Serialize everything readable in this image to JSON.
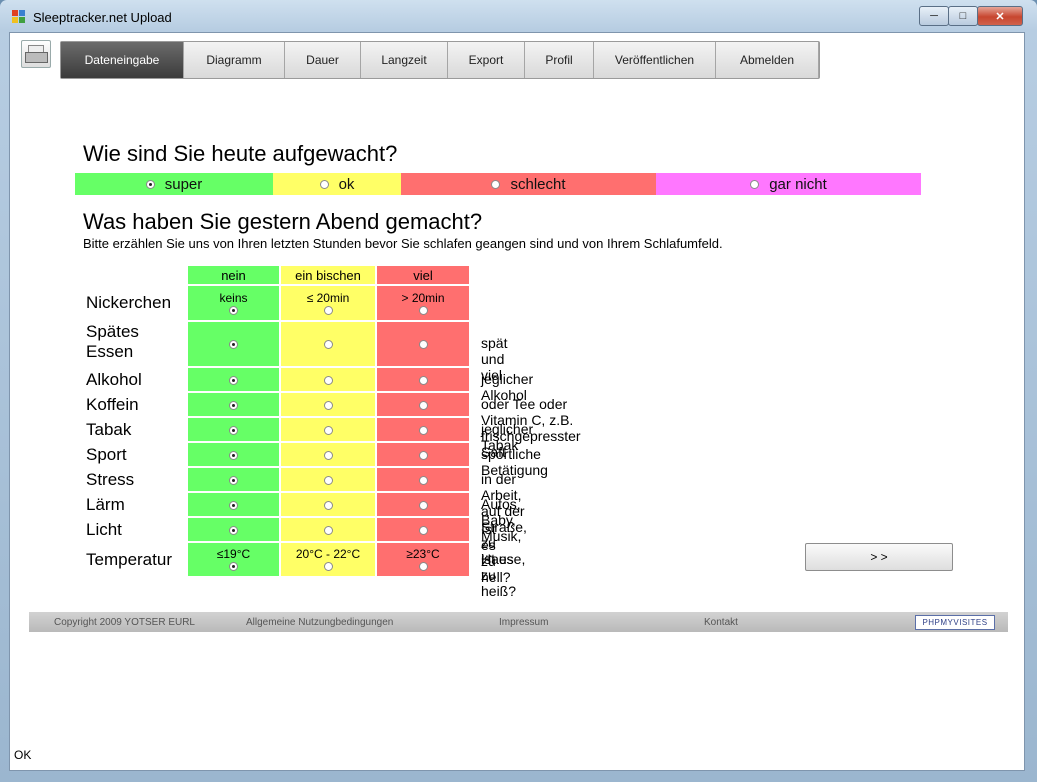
{
  "window": {
    "title": "Sleeptracker.net Upload",
    "status": "OK"
  },
  "nav": {
    "tabs": [
      "Dateneingabe",
      "Diagramm",
      "Dauer",
      "Langzeit",
      "Export",
      "Profil",
      "Veröffentlichen",
      "Abmelden"
    ],
    "active": "Dateneingabe"
  },
  "q1": {
    "title": "Wie sind Sie heute aufgewacht?",
    "options": [
      {
        "label": "super",
        "color": "#66ff66",
        "selected": true
      },
      {
        "label": "ok",
        "color": "#ffff66",
        "selected": false
      },
      {
        "label": "schlecht",
        "color": "#ff6f6f",
        "selected": false
      },
      {
        "label": "gar nicht",
        "color": "#ff77ff",
        "selected": false
      }
    ]
  },
  "q2": {
    "title": "Was haben Sie gestern Abend gemacht?",
    "subtitle": "Bitte erzählen Sie uns von Ihren letzten Stunden bevor Sie schlafen geangen sind und von Ihrem Schlafumfeld.",
    "columns": [
      "nein",
      "ein bischen",
      "viel"
    ],
    "rows": [
      {
        "label": "Nickerchen",
        "sub": [
          "keins",
          "≤ 20min",
          "> 20min"
        ],
        "note": "",
        "selected": 0
      },
      {
        "label": "Spätes Essen",
        "sub": [
          "",
          "",
          ""
        ],
        "note": "spät und viel",
        "selected": 0
      },
      {
        "label": "Alkohol",
        "sub": [
          "",
          "",
          ""
        ],
        "note": "jeglicher Alkohol",
        "selected": 0
      },
      {
        "label": "Koffein",
        "sub": [
          "",
          "",
          ""
        ],
        "note": "oder Tee oder Vitamin C, z.B. frischgepresster Saft",
        "selected": 0
      },
      {
        "label": "Tabak",
        "sub": [
          "",
          "",
          ""
        ],
        "note": "jeglicher Tabak",
        "selected": 0
      },
      {
        "label": "Sport",
        "sub": [
          "",
          "",
          ""
        ],
        "note": "sportliche Betätigung",
        "selected": 0
      },
      {
        "label": "Stress",
        "sub": [
          "",
          "",
          ""
        ],
        "note": "in der Arbeit, auf der Straße, zu Hause, ..",
        "selected": 0
      },
      {
        "label": "Lärm",
        "sub": [
          "",
          "",
          ""
        ],
        "note": "Autos, Baby, Musik, ...",
        "selected": 0
      },
      {
        "label": "Licht",
        "sub": [
          "",
          "",
          ""
        ],
        "note": "Ist es zu hell?",
        "selected": 0
      },
      {
        "label": "Temperatur",
        "sub": [
          "≤19°C",
          "20°C - 22°C",
          "≥23°C"
        ],
        "note": "ist es zu heiß?",
        "selected": 0
      }
    ],
    "next_label": "> >"
  },
  "footer": {
    "copyright": "Copyright 2009 YOTSER EURL",
    "terms": "Allgemeine Nutzungbedingungen",
    "impressum": "Impressum",
    "contact": "Kontakt",
    "badge": "PHPMYVISITES"
  }
}
